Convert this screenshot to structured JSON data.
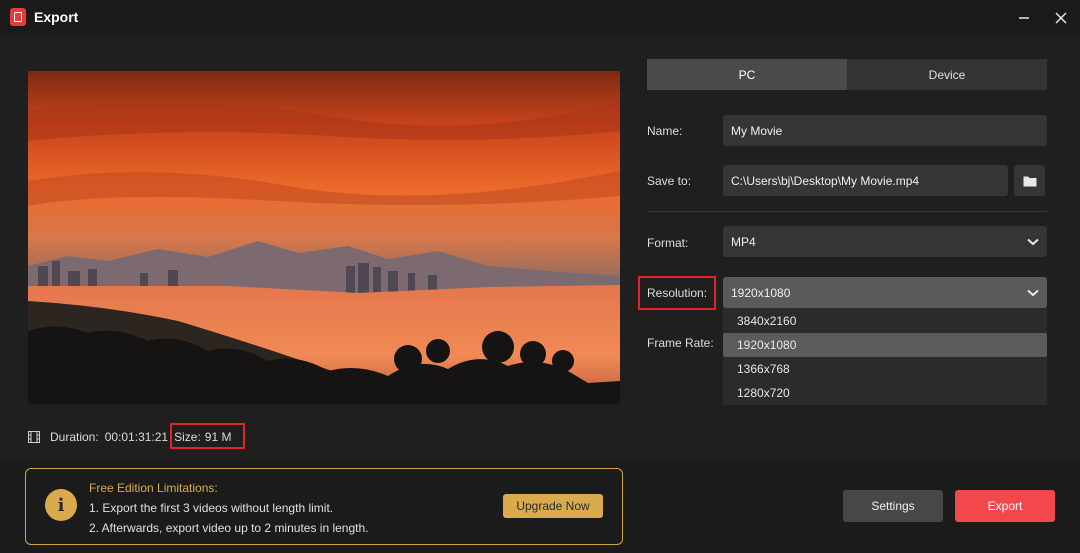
{
  "window": {
    "title": "Export"
  },
  "tabs": [
    {
      "label": "PC"
    },
    {
      "label": "Device"
    }
  ],
  "form": {
    "name_label": "Name:",
    "name_value": "My Movie",
    "save_label": "Save to:",
    "save_value": "C:\\Users\\bj\\Desktop\\My Movie.mp4",
    "format_label": "Format:",
    "format_value": "MP4",
    "resolution_label": "Resolution:",
    "resolution_value": "1920x1080",
    "frame_rate_label": "Frame Rate:",
    "resolution_options": [
      "3840x2160",
      "1920x1080",
      "1366x768",
      "1280x720"
    ]
  },
  "info": {
    "duration_label": "Duration:",
    "duration_value": "00:01:31:21",
    "size_label": "Size:",
    "size_value": "91 M"
  },
  "notice": {
    "title": "Free Edition Limitations:",
    "line1": "1. Export the first 3 videos without length limit.",
    "line2": "2. Afterwards, export video up to 2 minutes in length.",
    "upgrade_label": "Upgrade Now"
  },
  "actions": {
    "settings_label": "Settings",
    "export_label": "Export"
  },
  "colors": {
    "accent_red": "#f2474b",
    "notice_gold": "#d9ab4c",
    "highlight_box": "#e0252a"
  },
  "icons": [
    "app-logo-icon",
    "minimize-icon",
    "close-icon",
    "folder-icon",
    "chevron-down-icon",
    "film-icon",
    "info-icon"
  ]
}
